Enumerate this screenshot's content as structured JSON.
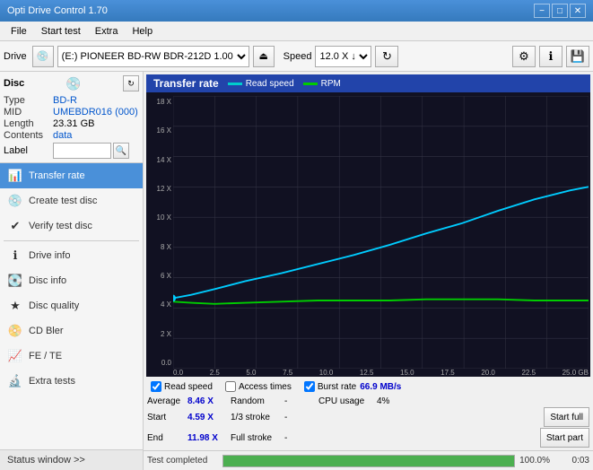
{
  "titlebar": {
    "title": "Opti Drive Control 1.70",
    "minimize": "−",
    "maximize": "□",
    "close": "✕"
  },
  "menubar": {
    "items": [
      "File",
      "Start test",
      "Extra",
      "Help"
    ]
  },
  "toolbar": {
    "drive_label": "Drive",
    "drive_value": "(E:) PIONEER BD-RW  BDR-212D 1.00",
    "speed_label": "Speed",
    "speed_value": "12.0 X ↓"
  },
  "disc": {
    "type_label": "Type",
    "type_value": "BD-R",
    "mid_label": "MID",
    "mid_value": "UMEBDR016 (000)",
    "length_label": "Length",
    "length_value": "23.31 GB",
    "contents_label": "Contents",
    "contents_value": "data",
    "label_label": "Label",
    "label_value": ""
  },
  "nav": {
    "items": [
      {
        "id": "transfer-rate",
        "label": "Transfer rate",
        "icon": "📊",
        "active": true
      },
      {
        "id": "create-test-disc",
        "label": "Create test disc",
        "icon": "💿",
        "active": false
      },
      {
        "id": "verify-test-disc",
        "label": "Verify test disc",
        "icon": "✔",
        "active": false
      },
      {
        "id": "drive-info",
        "label": "Drive info",
        "icon": "ℹ",
        "active": false
      },
      {
        "id": "disc-info",
        "label": "Disc info",
        "icon": "💽",
        "active": false
      },
      {
        "id": "disc-quality",
        "label": "Disc quality",
        "icon": "★",
        "active": false
      },
      {
        "id": "cd-bler",
        "label": "CD Bler",
        "icon": "📀",
        "active": false
      },
      {
        "id": "fe-te",
        "label": "FE / TE",
        "icon": "📈",
        "active": false
      },
      {
        "id": "extra-tests",
        "label": "Extra tests",
        "icon": "🔬",
        "active": false
      }
    ]
  },
  "status_window": "Status window >>",
  "chart": {
    "title": "Transfer rate",
    "legend": [
      {
        "id": "read-speed",
        "label": "Read speed",
        "color": "#00cccc"
      },
      {
        "id": "rpm",
        "label": "RPM",
        "color": "#00cc00"
      }
    ],
    "y_labels": [
      "18 X",
      "16 X",
      "14 X",
      "12 X",
      "10 X",
      "8 X",
      "6 X",
      "4 X",
      "2 X",
      "0.0"
    ],
    "x_labels": [
      "0.0",
      "2.5",
      "5.0",
      "7.5",
      "10.0",
      "12.5",
      "15.0",
      "17.5",
      "20.0",
      "22.5",
      "25.0 GB"
    ]
  },
  "checkboxes": [
    {
      "id": "read-speed-check",
      "label": "Read speed",
      "checked": true
    },
    {
      "id": "access-times-check",
      "label": "Access times",
      "checked": false
    },
    {
      "id": "burst-rate-check",
      "label": "Burst rate",
      "checked": true
    }
  ],
  "burst_rate_value": "66.9 MB/s",
  "stats": {
    "average_label": "Average",
    "average_value": "8.46 X",
    "random_label": "Random",
    "random_value": "-",
    "cpu_label": "CPU usage",
    "cpu_value": "4%",
    "start_label": "Start",
    "start_value": "4.59 X",
    "stroke1_label": "1/3 stroke",
    "stroke1_value": "-",
    "btn_full": "Start full",
    "end_label": "End",
    "end_value": "11.98 X",
    "stroke2_label": "Full stroke",
    "stroke2_value": "-",
    "btn_part": "Start part"
  },
  "statusbar": {
    "text": "Test completed",
    "progress": 100,
    "percent": "100.0%",
    "time": "0:03"
  }
}
